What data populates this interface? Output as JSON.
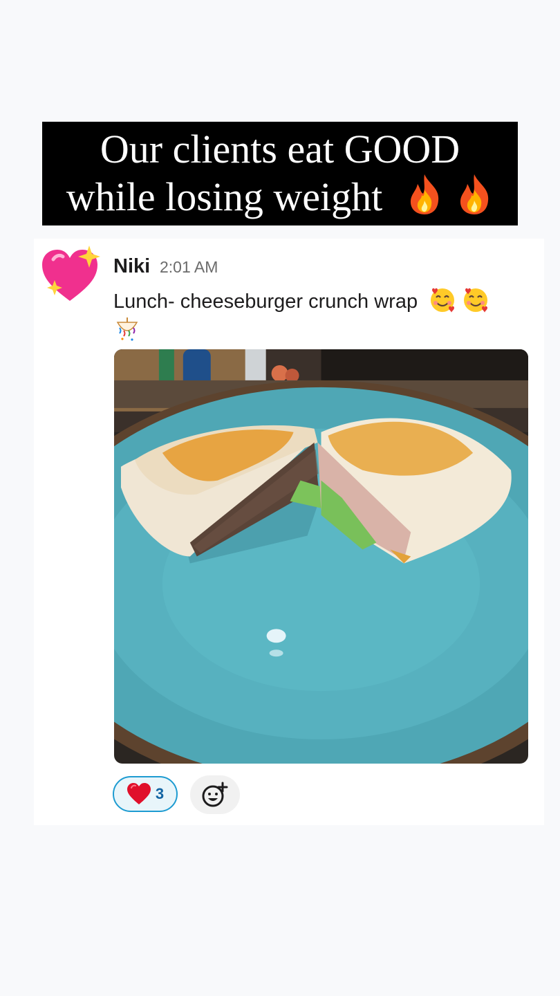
{
  "banner": {
    "line1": "Our clients eat GOOD",
    "line2": "while losing weight"
  },
  "message": {
    "avatar_icon": "sparkling-heart-icon",
    "author": "Niki",
    "time": "2:01 AM",
    "text": "Lunch- cheeseburger crunch wrap",
    "emojis": [
      "smiling-face-with-hearts-icon",
      "smiling-face-with-hearts-icon",
      "confetti-ball-icon"
    ],
    "image_icon": "food-photo-icon"
  },
  "reactions": [
    {
      "icon": "red-heart-icon",
      "count": "3"
    }
  ],
  "add_reaction_icon": "add-reaction-icon",
  "colors": {
    "banner_bg": "#000000",
    "reaction_border": "#1d9bd1",
    "reaction_count": "#1264a3"
  }
}
